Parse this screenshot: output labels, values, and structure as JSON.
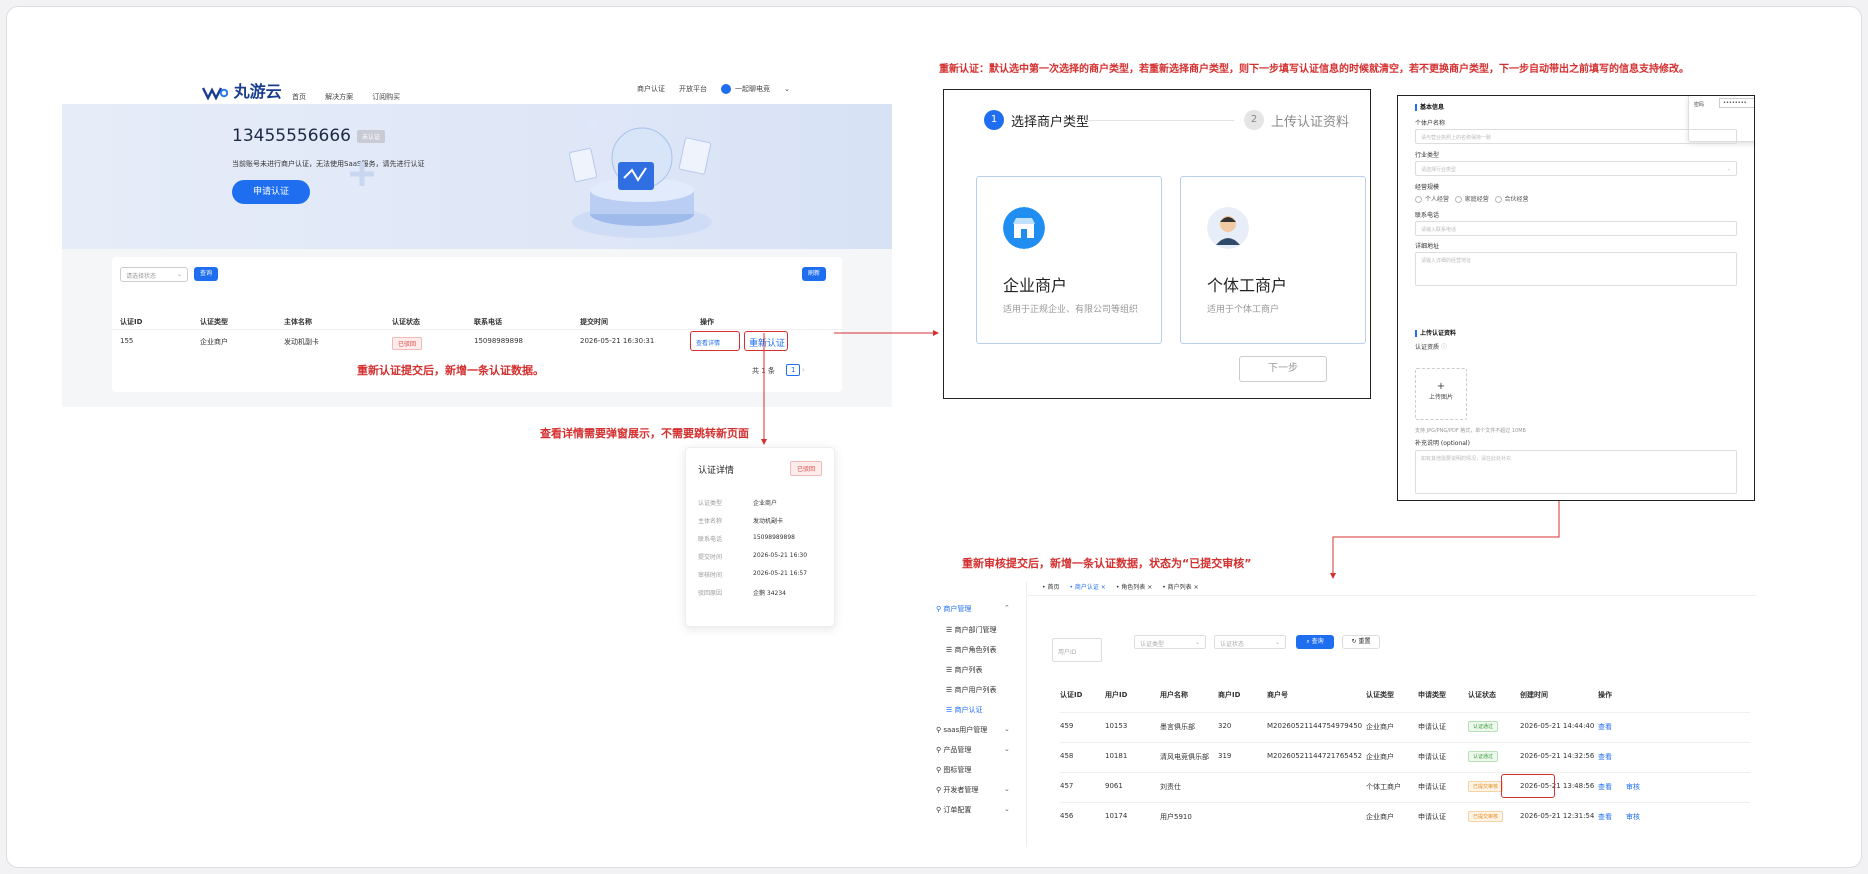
{
  "annotations": {
    "top_note": "重新认证：默认选中第一次选择的商户类型，若重新选择商户类型，则下一步填写认证信息的时候就清空，若不更换商户类型，下一步自动带出之前填写的信息支持修改。",
    "reauth_note": "重新认证提交后，新增一条认证数据。",
    "detail_note": "查看详情需要弹窗展示，不需要跳转新页面",
    "admin_note": "重新审核提交后，新增一条认证数据，状态为“已提交审核”"
  },
  "portal": {
    "logo": "丸游云",
    "nav": [
      "首页",
      "解决方案",
      "订阅购买"
    ],
    "nav_right": [
      "商户认证",
      "开放平台"
    ],
    "account": "一起聊电竞",
    "phone": "13455556666",
    "phone_tag": "未认证",
    "banner_sub": "当前账号未进行商户认证，无法使用SaaS服务，请先进行认证",
    "apply_button": "申请认证",
    "filter_placeholder": "请选择状态",
    "query_button": "查询",
    "refresh_button": "刷新",
    "columns": [
      "认证ID",
      "认证类型",
      "主体名称",
      "认证状态",
      "联系电话",
      "提交时间",
      "操作"
    ],
    "row": {
      "id": "155",
      "type": "企业商户",
      "name": "发动机副卡",
      "status": "已驳回",
      "phone": "15098989898",
      "time": "2026-05-21 16:30:31",
      "view": "查看详情",
      "reauth": "重新认证"
    },
    "pagination": {
      "total": "共 1 条",
      "page": "1"
    }
  },
  "detail_modal": {
    "title": "认证详情",
    "status": "已驳回",
    "rows": [
      {
        "label": "认证类型",
        "value": "企业商户"
      },
      {
        "label": "主体名称",
        "value": "发动机副卡"
      },
      {
        "label": "联系电话",
        "value": "15098989898"
      },
      {
        "label": "提交时间",
        "value": "2026-05-21 16:30"
      },
      {
        "label": "审核时间",
        "value": "2026-05-21 16:57"
      },
      {
        "label": "驳回原因",
        "value": "企鹅 34234"
      }
    ]
  },
  "step_panel": {
    "step1_num": "1",
    "step1": "选择商户类型",
    "step2_num": "2",
    "step2": "上传认证资料",
    "card1_title": "企业商户",
    "card1_sub": "适用于正规企业、有限公司等组织",
    "card2_title": "个体工商户",
    "card2_sub": "适用于个体工商户",
    "next": "下一步"
  },
  "form_panel": {
    "pw_label": "密码",
    "pw_value": "••••••••",
    "basic_title": "基本信息",
    "name_label": "个体户名称",
    "name_ph": "请与营业执照上的名称保持一致",
    "industry_label": "行业类型",
    "industry_ph": "请选择行业类型",
    "mode_label": "经营规模",
    "modes": [
      "个人经营",
      "家庭经营",
      "合伙经营"
    ],
    "contact_label": "联系电话",
    "contact_ph": "请输入联系电话",
    "addr_label": "详细地址",
    "addr_ph": "请输入详细的经营地址",
    "upload_title": "上传认证资料",
    "license_label": "认证资质",
    "upload_text": "上传图片",
    "upload_hint": "支持 JPG/PNG/PDF 格式，单个文件不超过 10MB",
    "note_label": "补充说明 (optional)",
    "note_ph": "如有其他需要说明的情况，请在此处补充"
  },
  "admin": {
    "sidebar": [
      {
        "label": "商户管理",
        "active": true,
        "chev": "^"
      },
      {
        "label": "商户部门管理",
        "sub": true
      },
      {
        "label": "商户角色列表",
        "sub": true
      },
      {
        "label": "商户列表",
        "sub": true
      },
      {
        "label": "商户用户列表",
        "sub": true
      },
      {
        "label": "商户认证",
        "sub": true,
        "active": true
      },
      {
        "label": "saas用户管理",
        "chev": "v"
      },
      {
        "label": "产品管理",
        "chev": "v"
      },
      {
        "label": "图标管理"
      },
      {
        "label": "开发者管理",
        "chev": "v"
      },
      {
        "label": "订单配置",
        "chev": "v"
      }
    ],
    "tabs": [
      "首页",
      "商户认证 ×",
      "角色列表 ×",
      "商户列表 ×"
    ],
    "filters": {
      "user_id": "用户ID",
      "auth_type": "认证类型",
      "auth_status": "认证状态",
      "query": "查询",
      "reset": "重置"
    },
    "columns": [
      "认证ID",
      "用户ID",
      "用户名称",
      "商户ID",
      "商户号",
      "认证类型",
      "申请类型",
      "认证状态",
      "创建时间",
      "操作"
    ],
    "rows": [
      {
        "id": "459",
        "uid": "10153",
        "uname": "墨言俱乐部",
        "mid": "320",
        "mno": "M20260521144754979450",
        "type": "企业商户",
        "apply": "申请认证",
        "status": "认证通过",
        "kind": "ok",
        "time": "2026-05-21 14:44:40",
        "view": "查看",
        "audit": ""
      },
      {
        "id": "458",
        "uid": "10181",
        "uname": "清风电竞俱乐部",
        "mid": "319",
        "mno": "M20260521144721765452",
        "type": "企业商户",
        "apply": "申请认证",
        "status": "认证通过",
        "kind": "ok",
        "time": "2026-05-21 14:32:56",
        "view": "查看",
        "audit": ""
      },
      {
        "id": "457",
        "uid": "9061",
        "uname": "刘责仕",
        "mid": "",
        "mno": "",
        "type": "个体工商户",
        "apply": "申请认证",
        "status": "已提交审核",
        "kind": "pend",
        "time": "2026-05-21 13:48:56",
        "view": "查看",
        "audit": "审核"
      },
      {
        "id": "456",
        "uid": "10174",
        "uname": "用户5910",
        "mid": "",
        "mno": "",
        "type": "企业商户",
        "apply": "申请认证",
        "status": "已提交审核",
        "kind": "pend",
        "time": "2026-05-21 12:31:54",
        "view": "查看",
        "audit": "审核"
      }
    ]
  }
}
